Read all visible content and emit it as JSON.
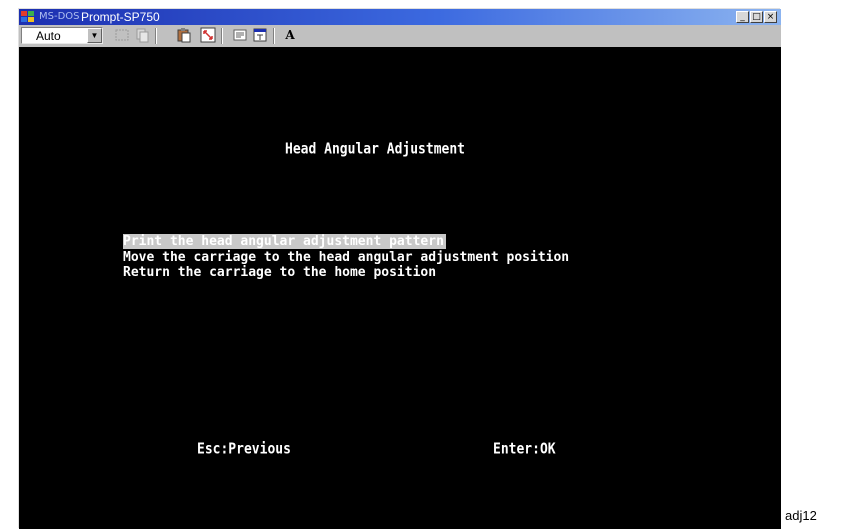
{
  "window": {
    "title_prefix": "MS-DOS",
    "title": "Prompt-SP750",
    "buttons": {
      "minimize": "_",
      "maximize": "□",
      "close": "×"
    }
  },
  "toolbar": {
    "font_value": "Auto",
    "font_arrow": "▼",
    "font_button_glyph": "A",
    "buttons": [
      "mark-icon",
      "copy-icon",
      "paste-icon",
      "fullscreen-icon",
      "properties-icon",
      "background-icon",
      "font-icon"
    ]
  },
  "screen": {
    "title": "Head Angular Adjustment",
    "menu": [
      {
        "label": "Print the head angular adjustment pattern",
        "selected": true
      },
      {
        "label": "Move the carriage to the head angular adjustment position",
        "selected": false
      },
      {
        "label": "Return the carriage to the home position",
        "selected": false
      }
    ],
    "footer_left": "Esc:Previous",
    "footer_right": "Enter:OK"
  },
  "caption": "adj12",
  "colors": {
    "titlebar_start": "#1c2fb0",
    "titlebar_end": "#8cb4f0",
    "screen_bg": "#000000",
    "screen_text": "#ffffff",
    "selection_bg": "#c8c8c8",
    "window_chrome": "#c0c0c0"
  }
}
